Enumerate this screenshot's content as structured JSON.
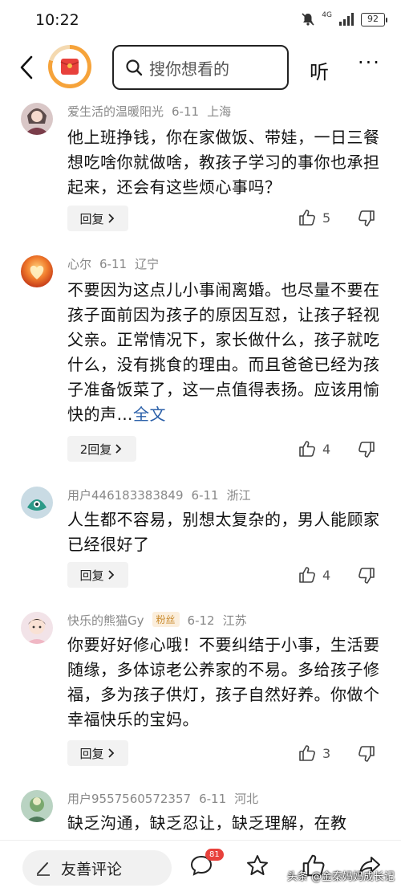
{
  "status_bar": {
    "time": "10:22",
    "signal_label": "4G",
    "battery": "92"
  },
  "header": {
    "search_placeholder": "搜你想看的",
    "listen_label": "听",
    "more_label": "···"
  },
  "comments": [
    {
      "user": "爱生活的温暖阳光",
      "date": "6-11",
      "location": "上海",
      "text": "他上班挣钱，你在家做饭、带娃，一日三餐想吃啥你就做啥，教孩子学习的事你也承担起来，还会有这些烦心事吗？",
      "reply_label": "回复",
      "likes": "5"
    },
    {
      "user": "心尔",
      "date": "6-11",
      "location": "辽宁",
      "text": "不要因为这点儿小事闹离婚。也尽量不要在孩子面前因为孩子的原因互怼，让孩子轻视父亲。正常情况下，家长做什么，孩子就吃什么，没有挑食的理由。而且爸爸已经为孩子准备饭菜了，这一点值得表扬。应该用愉快的声…",
      "fulltext_label": "全文",
      "reply_label": "2回复",
      "likes": "4"
    },
    {
      "user": "用户446183383849",
      "date": "6-11",
      "location": "浙江",
      "text": "人生都不容易，别想太复杂的，男人能顾家已经很好了",
      "reply_label": "回复",
      "likes": "4"
    },
    {
      "user": "快乐的熊猫Gy",
      "badge": "粉丝",
      "date": "6-12",
      "location": "江苏",
      "text": "你要好好修心哦！不要纠结于小事，生活要随缘，多体谅老公养家的不易。多给孩子修福，多为孩子供灯，孩子自然好养。你做个幸福快乐的宝妈。",
      "reply_label": "回复",
      "likes": "3"
    },
    {
      "user": "用户9557560572357",
      "date": "6-11",
      "location": "河北",
      "text": "缺乏沟通，缺乏忍让，缺乏理解，在教"
    }
  ],
  "bottom_bar": {
    "comment_placeholder": "友善评论",
    "comment_count": "81",
    "watermark": "头条 @金秦妈妈成长记"
  },
  "colors": {
    "accent": "#e8413c",
    "link": "#2a5fa8",
    "meta": "#888888",
    "logo_orange": "#f6a33a"
  }
}
